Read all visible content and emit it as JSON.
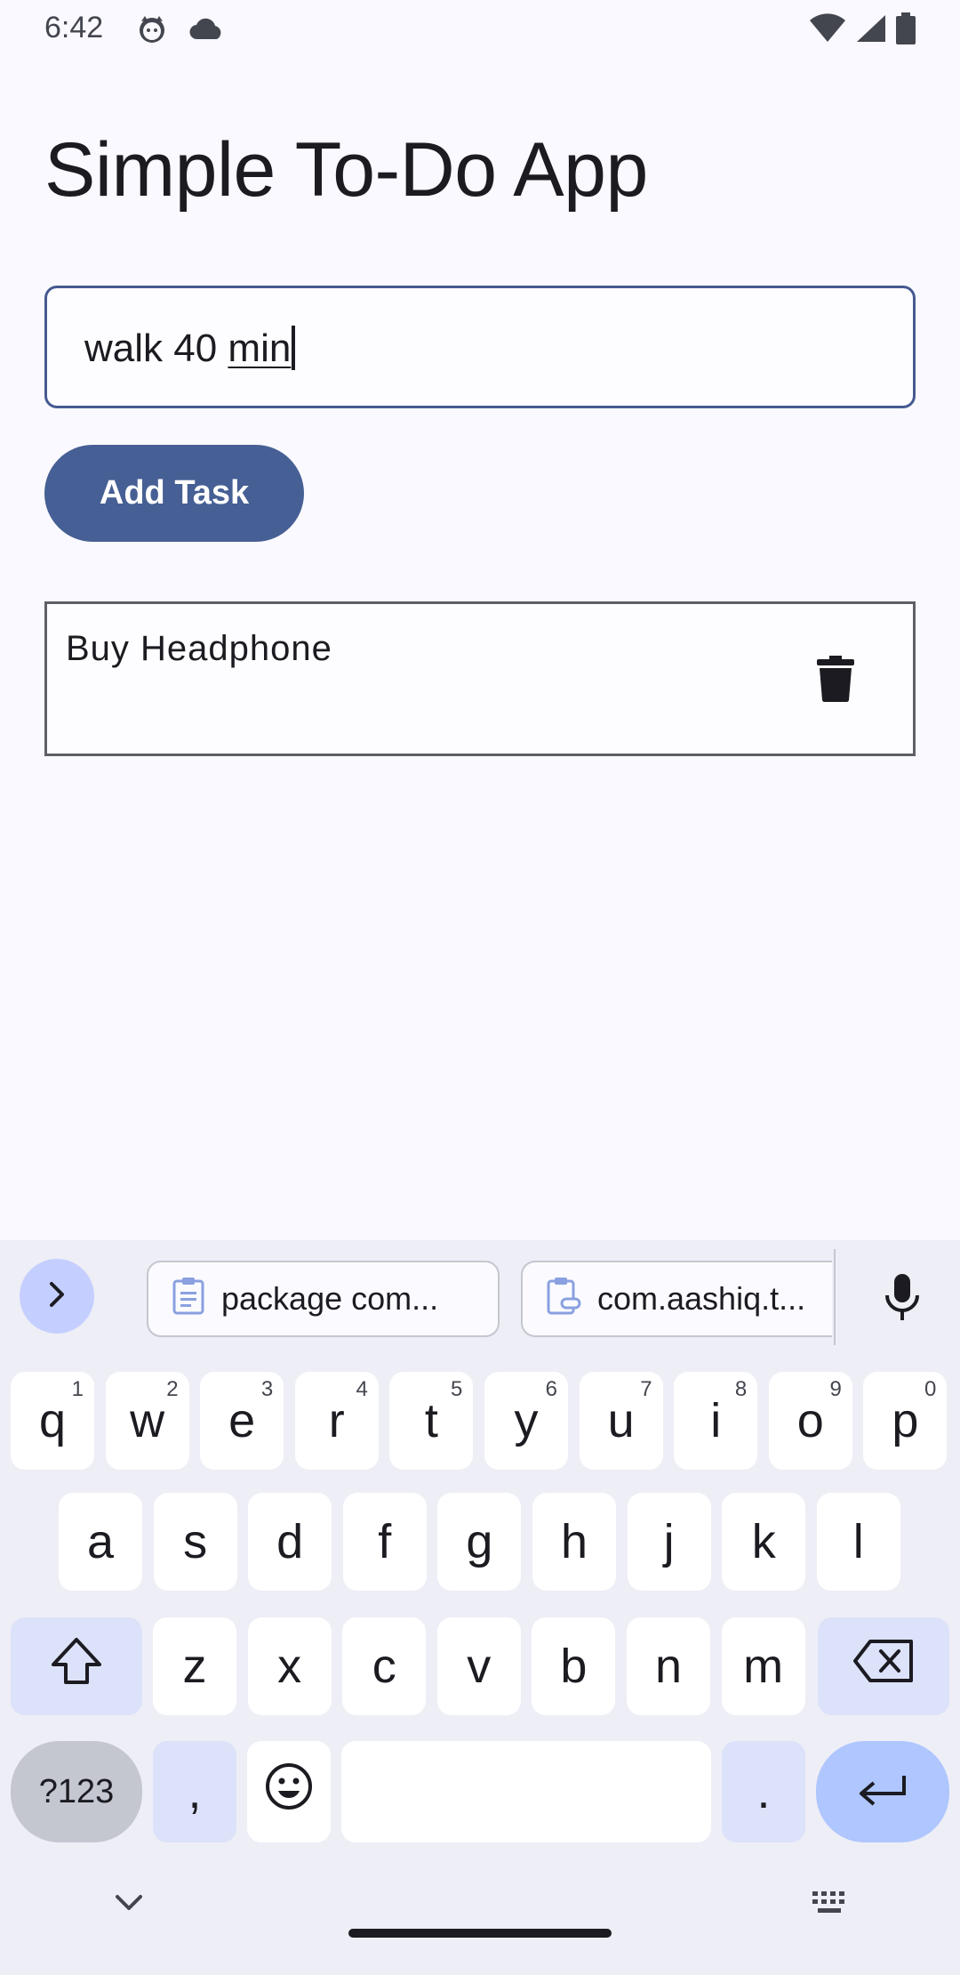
{
  "status_bar": {
    "time": "6:42",
    "left_icons": [
      "cat-face-icon",
      "cloud-icon"
    ],
    "right_icons": [
      "wifi-icon",
      "signal-icon",
      "battery-icon"
    ]
  },
  "app": {
    "title": "Simple To-Do App",
    "input": {
      "value_plain": "walk 40 ",
      "value_composing": "min"
    },
    "add_button_label": "Add Task",
    "tasks": [
      {
        "label": "Buy Headphone"
      }
    ]
  },
  "keyboard": {
    "suggestions": [
      {
        "icon": "clipboard-icon",
        "text": "package com..."
      },
      {
        "icon": "clipboard-link-icon",
        "text": "com.aashiq.t..."
      }
    ],
    "rows": [
      [
        {
          "label": "q",
          "hint": "1"
        },
        {
          "label": "w",
          "hint": "2"
        },
        {
          "label": "e",
          "hint": "3"
        },
        {
          "label": "r",
          "hint": "4"
        },
        {
          "label": "t",
          "hint": "5"
        },
        {
          "label": "y",
          "hint": "6"
        },
        {
          "label": "u",
          "hint": "7"
        },
        {
          "label": "i",
          "hint": "8"
        },
        {
          "label": "o",
          "hint": "9"
        },
        {
          "label": "p",
          "hint": "0"
        }
      ],
      [
        {
          "label": "a"
        },
        {
          "label": "s"
        },
        {
          "label": "d"
        },
        {
          "label": "f"
        },
        {
          "label": "g"
        },
        {
          "label": "h"
        },
        {
          "label": "j"
        },
        {
          "label": "k"
        },
        {
          "label": "l"
        }
      ],
      [
        {
          "label": "z"
        },
        {
          "label": "x"
        },
        {
          "label": "c"
        },
        {
          "label": "v"
        },
        {
          "label": "b"
        },
        {
          "label": "n"
        },
        {
          "label": "m"
        }
      ]
    ],
    "symbols_label": "?123",
    "comma_label": ",",
    "period_label": "."
  }
}
